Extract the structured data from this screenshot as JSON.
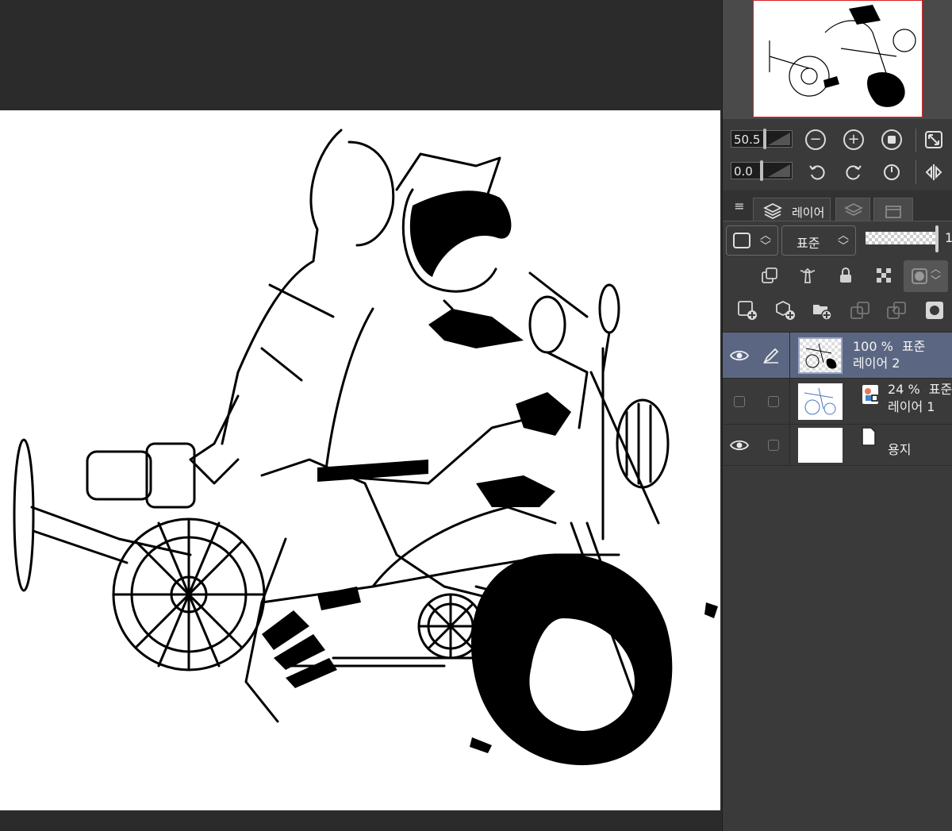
{
  "navigator": {
    "zoom_value": "50.5",
    "rotation_value": "0.0"
  },
  "layer_palette": {
    "tab_label": "레이어",
    "blend_mode": "표준",
    "opacity_partial": "1"
  },
  "layers": [
    {
      "opacity": "100 %",
      "mode": "표준",
      "name": "레이어 2",
      "visible": true,
      "selected": true
    },
    {
      "opacity": "24 %",
      "mode": "표준",
      "name": "레이어 1",
      "visible": false,
      "selected": false
    },
    {
      "name": "용지",
      "visible": true,
      "selected": false
    }
  ],
  "colors": {
    "selection": "#5b6782",
    "panel": "#3a3a3a",
    "workspace": "#2b2b2b",
    "navigator_frame": "#dd2222"
  }
}
